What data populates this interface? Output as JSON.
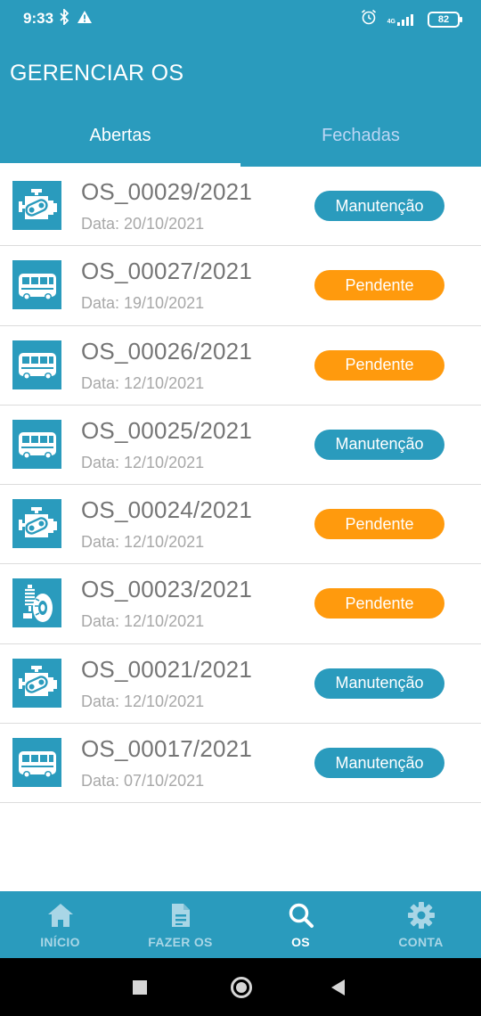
{
  "status_bar": {
    "time": "9:33",
    "network": "4G",
    "battery": "82"
  },
  "app_bar": {
    "title": "GERENCIAR OS"
  },
  "tabs": [
    {
      "label": "Abertas",
      "active": true
    },
    {
      "label": "Fechadas",
      "active": false
    }
  ],
  "orders": [
    {
      "code": "OS_00029/2021",
      "date": "Data: 20/10/2021",
      "status": "Manutenção",
      "icon": "engine-icon",
      "status_color": "#2a9bbd"
    },
    {
      "code": "OS_00027/2021",
      "date": "Data: 19/10/2021",
      "status": "Pendente",
      "icon": "bus-icon",
      "status_color": "#ff9a0d"
    },
    {
      "code": "OS_00026/2021",
      "date": "Data: 12/10/2021",
      "status": "Pendente",
      "icon": "bus-icon",
      "status_color": "#ff9a0d"
    },
    {
      "code": "OS_00025/2021",
      "date": "Data: 12/10/2021",
      "status": "Manutenção",
      "icon": "bus-icon",
      "status_color": "#2a9bbd"
    },
    {
      "code": "OS_00024/2021",
      "date": "Data: 12/10/2021",
      "status": "Pendente",
      "icon": "engine-icon",
      "status_color": "#ff9a0d"
    },
    {
      "code": "OS_00023/2021",
      "date": "Data: 12/10/2021",
      "status": "Pendente",
      "icon": "suspension-wheel-icon",
      "status_color": "#ff9a0d"
    },
    {
      "code": "OS_00021/2021",
      "date": "Data: 12/10/2021",
      "status": "Manutenção",
      "icon": "engine-icon",
      "status_color": "#2a9bbd"
    },
    {
      "code": "OS_00017/2021",
      "date": "Data: 07/10/2021",
      "status": "Manutenção",
      "icon": "bus-icon",
      "status_color": "#2a9bbd"
    }
  ],
  "bottom_nav": [
    {
      "label": "INÍCIO",
      "icon": "home-icon",
      "active": false
    },
    {
      "label": "FAZER OS",
      "icon": "document-icon",
      "active": false
    },
    {
      "label": "OS",
      "icon": "search-icon",
      "active": true
    },
    {
      "label": "CONTA",
      "icon": "gear-icon",
      "active": false
    }
  ],
  "colors": {
    "primary": "#2a9bbd",
    "pending": "#ff9a0d",
    "title_text": "#757575",
    "date_text": "#a8a8a8"
  }
}
